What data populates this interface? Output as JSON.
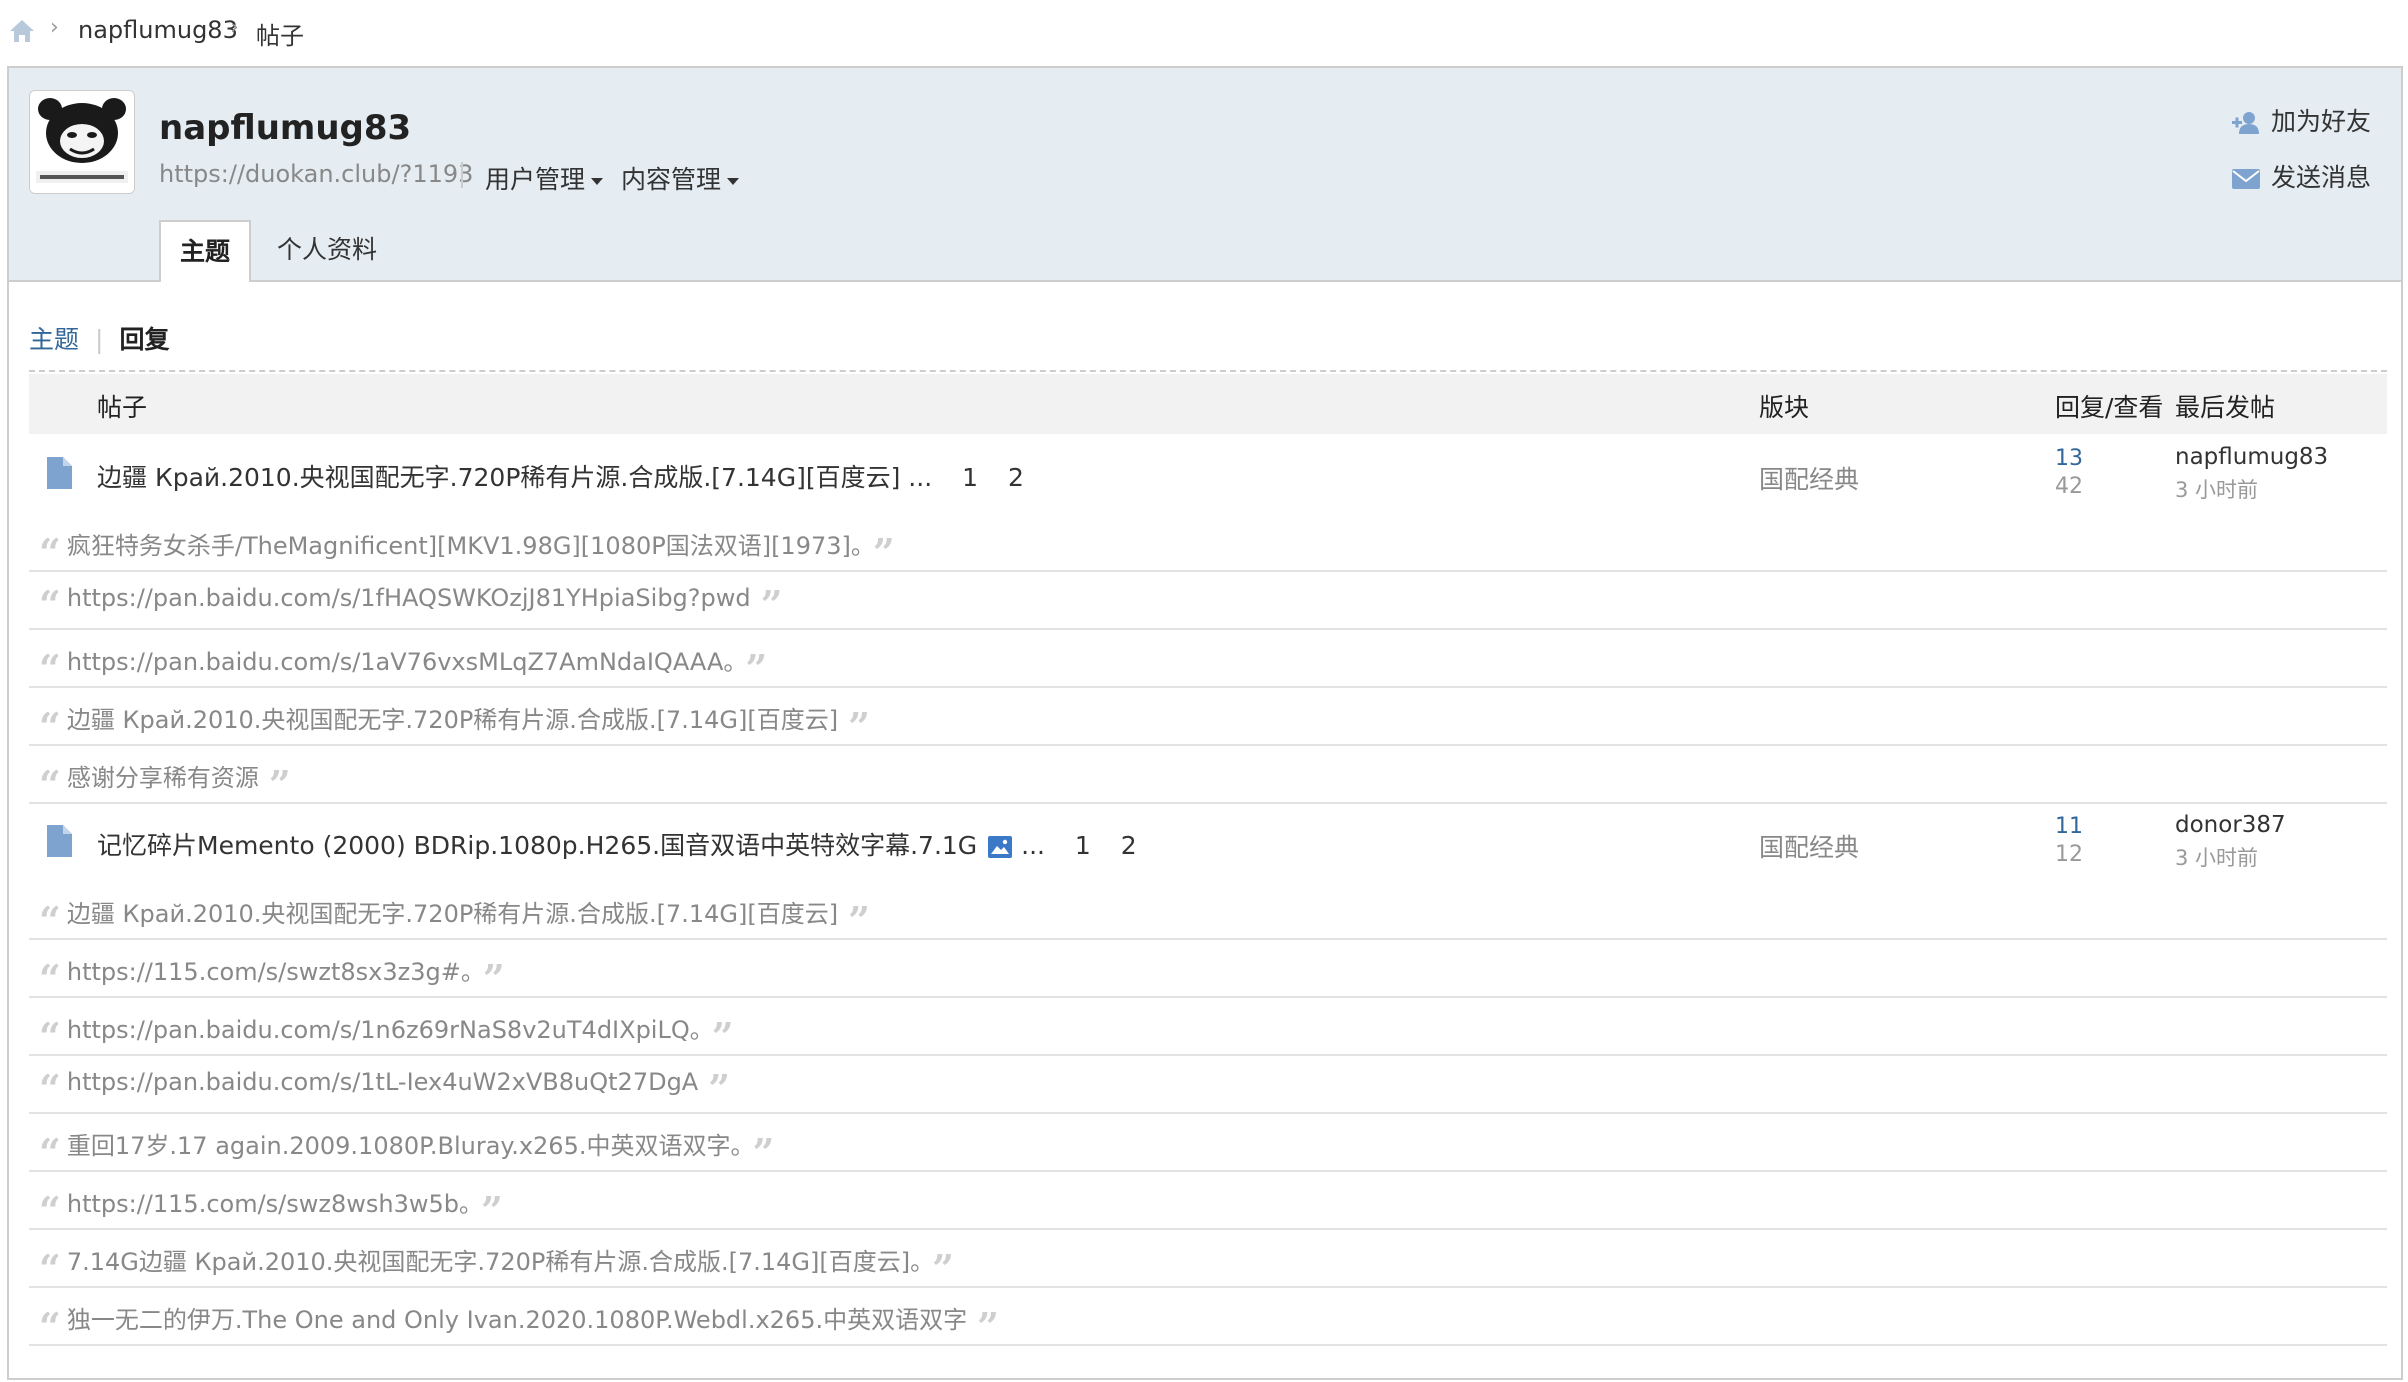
{
  "breadcrumb": {
    "items": [
      "napflumug83",
      "帖子"
    ]
  },
  "profile": {
    "username": "napflumug83",
    "url": "https://duokan.club/?1193",
    "menus": [
      "用户管理",
      "内容管理"
    ],
    "actions": {
      "add_friend": "加为好友",
      "send_message": "发送消息"
    },
    "tabs": [
      "主题",
      "个人资料"
    ]
  },
  "subnav": {
    "topics": "主题",
    "replies": "回复"
  },
  "table": {
    "headers": {
      "post": "帖子",
      "forum": "版块",
      "reply_view": "回复/查看",
      "last_post": "最后发帖"
    },
    "threads": [
      {
        "title": "边疆 Край.2010.央视国配无字.720P稀有片源.合成版.[7.14G][百度云]",
        "ellipsis": "...",
        "pages": [
          "1",
          "2"
        ],
        "forum": "国配经典",
        "replies": "13",
        "views": "42",
        "last_user": "napflumug83",
        "last_time": "3 小时前",
        "quotes": [
          "疯狂特务女杀手/TheMagnificent][MKV1.98G][1080P国法双语][1973]。",
          "https://pan.baidu.com/s/1fHAQSWKOzjJ81YHpiaSibg?pwd",
          "https://pan.baidu.com/s/1aV76vxsMLqZ7AmNdaIQAAA。",
          "边疆 Край.2010.央视国配无字.720P稀有片源.合成版.[7.14G][百度云]",
          "感谢分享稀有资源"
        ]
      },
      {
        "title": "记忆碎片Memento (2000) BDRip.1080p.H265.国音双语中英特效字幕.7.1G",
        "ellipsis": "...",
        "pages": [
          "1",
          "2"
        ],
        "forum": "国配经典",
        "replies": "11",
        "views": "12",
        "last_user": "donor387",
        "last_time": "3 小时前",
        "quotes": [
          "边疆 Край.2010.央视国配无字.720P稀有片源.合成版.[7.14G][百度云]",
          "https://115.com/s/swzt8sx3z3g#。",
          "https://pan.baidu.com/s/1n6z69rNaS8v2uT4dIXpiLQ。",
          "https://pan.baidu.com/s/1tL-Iex4uW2xVB8uQt27DgA",
          "重回17岁.17 again.2009.1080P.Bluray.x265.中英双语双字。",
          "https://115.com/s/swz8wsh3w5b。",
          "7.14G边疆 Край.2010.央视国配无字.720P稀有片源.合成版.[7.14G][百度云]。",
          "独一无二的伊万.The One and Only Ivan.2020.1080P.Webdl.x265.中英双语双字"
        ]
      }
    ]
  },
  "colors": {
    "header_bg": "#e5edf2",
    "link": "#336699",
    "muted": "#888888",
    "icon_blue": "#7fa3cf"
  }
}
